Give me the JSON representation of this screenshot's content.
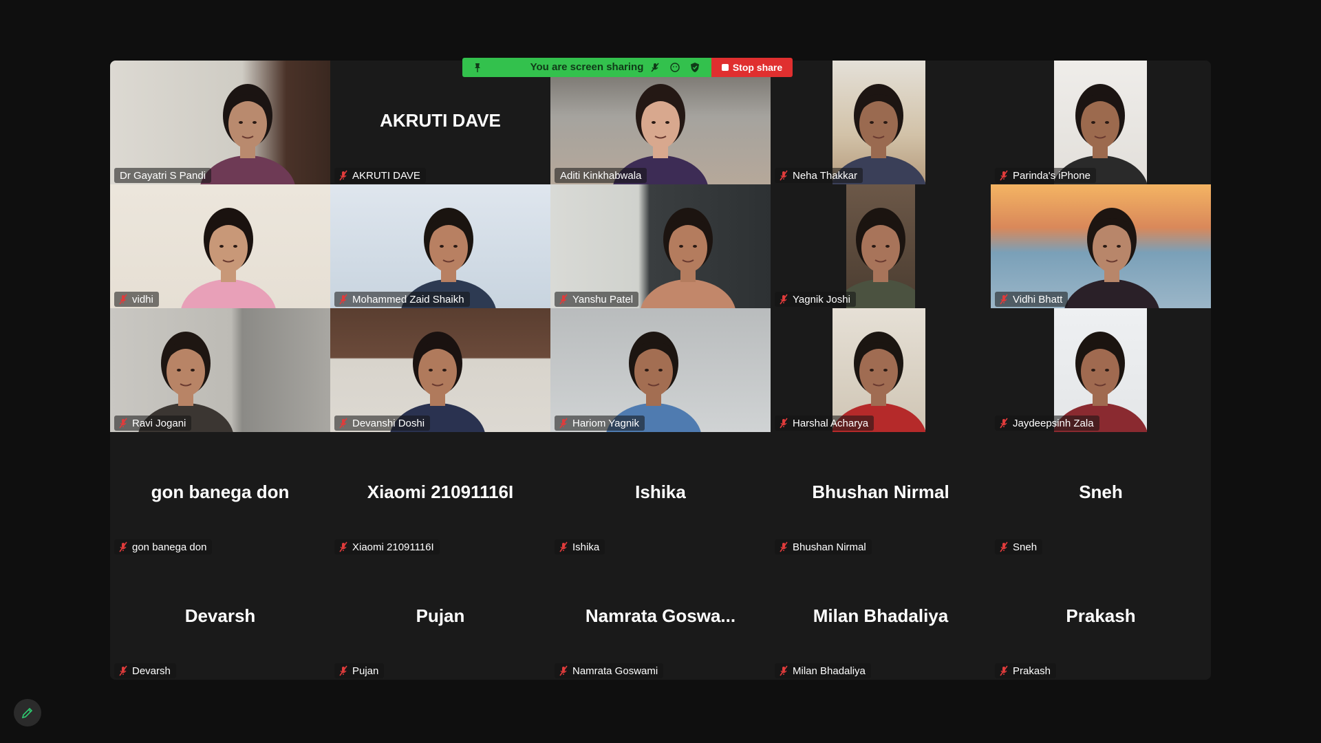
{
  "sharing_bar": {
    "status_text": "You are screen sharing",
    "stop_label": "Stop share",
    "icons": [
      "pin-icon",
      "mute-icon",
      "reaction-icon",
      "security-shield-icon"
    ]
  },
  "participants": [
    {
      "name": "Dr Gayatri S Pandi",
      "video": true,
      "muted": false
    },
    {
      "name": "AKRUTI DAVE",
      "video": false,
      "muted": true,
      "display": "AKRUTI DAVE"
    },
    {
      "name": "Aditi Kinkhabwala",
      "video": true,
      "muted": false,
      "active_speaker": true
    },
    {
      "name": "Neha Thakkar",
      "video": true,
      "muted": true
    },
    {
      "name": "Parinda's iPhone",
      "video": true,
      "muted": true
    },
    {
      "name": "vidhi",
      "video": true,
      "muted": true
    },
    {
      "name": "Mohammed Zaid Shaikh",
      "video": true,
      "muted": true
    },
    {
      "name": "Yanshu Patel",
      "video": true,
      "muted": true
    },
    {
      "name": "Yagnik Joshi",
      "video": true,
      "muted": true
    },
    {
      "name": "Vidhi Bhatt",
      "video": true,
      "muted": true
    },
    {
      "name": "Ravi Jogani",
      "video": true,
      "muted": true
    },
    {
      "name": "Devanshi Doshi",
      "video": true,
      "muted": true
    },
    {
      "name": "Hariom Yagnik",
      "video": true,
      "muted": true
    },
    {
      "name": "Harshal Acharya",
      "video": true,
      "muted": true
    },
    {
      "name": "Jaydeepsinh Zala",
      "video": true,
      "muted": true
    },
    {
      "name": "gon banega don",
      "video": false,
      "muted": true,
      "display": "gon banega don"
    },
    {
      "name": "Xiaomi 21091116I",
      "video": false,
      "muted": true,
      "display": "Xiaomi 21091116I"
    },
    {
      "name": "Ishika",
      "video": false,
      "muted": true,
      "display": "Ishika"
    },
    {
      "name": "Bhushan Nirmal",
      "video": false,
      "muted": true,
      "display": "Bhushan Nirmal"
    },
    {
      "name": "Sneh",
      "video": false,
      "muted": true,
      "display": "Sneh"
    },
    {
      "name": "Devarsh",
      "video": false,
      "muted": true,
      "display": "Devarsh"
    },
    {
      "name": "Pujan",
      "video": false,
      "muted": true,
      "display": "Pujan"
    },
    {
      "name": "Namrata Goswami",
      "video": false,
      "muted": true,
      "display": "Namrata  Goswa..."
    },
    {
      "name": "Milan Bhadaliya",
      "video": false,
      "muted": true,
      "display": "Milan Bhadaliya"
    },
    {
      "name": "Prakash",
      "video": false,
      "muted": true,
      "display": "Prakash"
    }
  ],
  "colors": {
    "background": "#0f0f0f",
    "gallery": "#1a1a1a",
    "share_green": "#33c14d",
    "stop_red": "#e02f2f",
    "active_speaker": "#2ecc71",
    "muted_mic": "#e03b3b"
  },
  "edit_button": {
    "icon": "pencil-icon"
  }
}
